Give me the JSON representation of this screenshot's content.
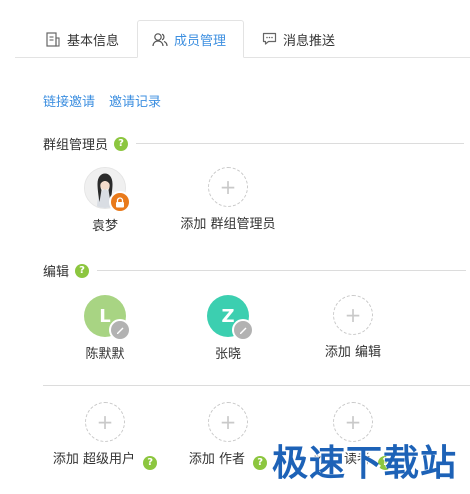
{
  "tabs": [
    {
      "label": "基本信息",
      "icon": "document-icon"
    },
    {
      "label": "成员管理",
      "icon": "users-icon",
      "active": true
    },
    {
      "label": "消息推送",
      "icon": "chat-icon"
    }
  ],
  "links": {
    "link_invite": "链接邀请",
    "invite_record": "邀请记录"
  },
  "help_symbol": "?",
  "plus_symbol": "+",
  "admins": {
    "title": "群组管理员",
    "members": [
      {
        "name": "袁梦"
      }
    ],
    "add_label": "添加 群组管理员"
  },
  "editors": {
    "title": "编辑",
    "members": [
      {
        "name": "陈默默",
        "initial": "L"
      },
      {
        "name": "张晓",
        "initial": "Z"
      }
    ],
    "add_label": "添加 编辑"
  },
  "others": {
    "add_superuser": "添加 超级用户",
    "add_author": "添加 作者",
    "add_reader": "添加 读者"
  },
  "colors": {
    "accent": "#3d8fe0",
    "help_green": "#8cc63f",
    "avatar_l": "#a8d483",
    "avatar_z": "#3ccfb0",
    "lock_badge": "#e97a1b",
    "edit_badge": "#b2b2b2"
  },
  "watermark": "极速下载站"
}
